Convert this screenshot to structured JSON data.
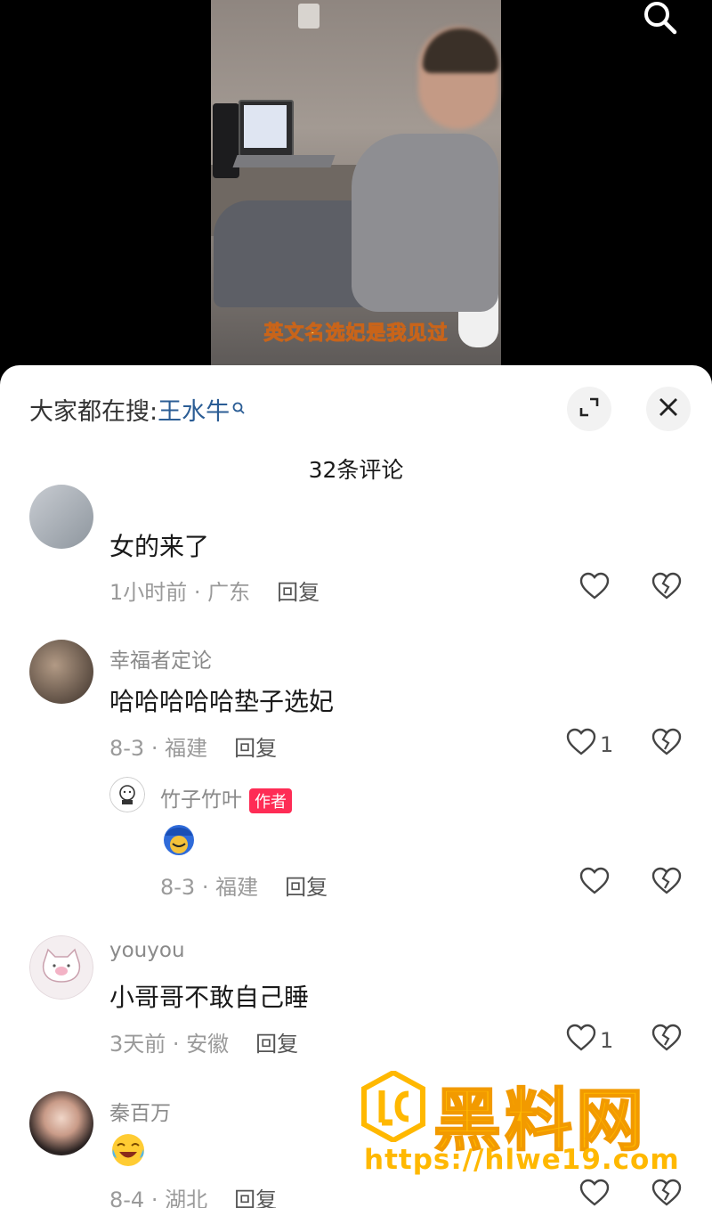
{
  "video": {
    "subtitle": "英文名选妃是我见过"
  },
  "sheet": {
    "trending_prefix": "大家都在搜:",
    "trending_keyword": "王水牛",
    "comment_count": "32条评论"
  },
  "comments": [
    {
      "username": "",
      "text": "女的来了",
      "time_location": "1小时前 · 广东",
      "reply_label": "回复",
      "likes": ""
    },
    {
      "username": "幸福者定论",
      "text": "哈哈哈哈哈垫子选妃",
      "time_location": "8-3 · 福建",
      "reply_label": "回复",
      "likes": "1"
    },
    {
      "username": "youyou",
      "text": "小哥哥不敢自己睡",
      "time_location": "3天前 · 安徽",
      "reply_label": "回复",
      "likes": "1"
    },
    {
      "username": "秦百万",
      "text": "",
      "time_location": "8-4 · 湖北",
      "reply_label": "回复",
      "likes": ""
    }
  ],
  "reply": {
    "username": "竹子竹叶",
    "badge": "作者",
    "time_location": "8-3 · 福建",
    "reply_label": "回复",
    "likes": ""
  },
  "watermark": {
    "title": "黑料网",
    "url": "https://hlwe19.com"
  },
  "colors": {
    "accent_link": "#2b5d95",
    "author_badge": "#fe2c55",
    "watermark": "#ffb800"
  }
}
